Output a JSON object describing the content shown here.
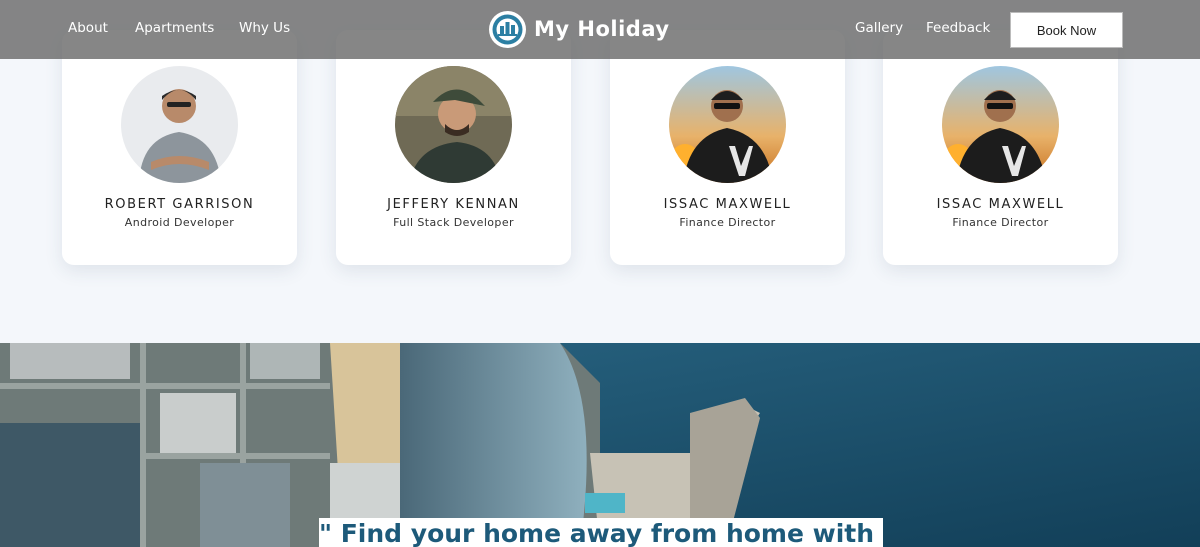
{
  "nav": {
    "left_links": [
      "About",
      "Apartments",
      "Why Us"
    ],
    "right_links": [
      "Gallery",
      "Feedback"
    ],
    "brand": "My Holiday",
    "book_label": "Book Now"
  },
  "team": [
    {
      "name": "ROBERT GARRISON",
      "role": "Android Developer"
    },
    {
      "name": "JEFFERY KENNAN",
      "role": "Full Stack Developer"
    },
    {
      "name": "ISSAC MAXWELL",
      "role": "Finance Director"
    },
    {
      "name": "ISSAC MAXWELL",
      "role": "Finance Director"
    }
  ],
  "hero": {
    "tagline": "\" Find your home away from home with us.\""
  },
  "colors": {
    "page_bg": "#f4f7fb",
    "navbar": "#646464",
    "tagline_text": "#1d5a7a",
    "sea": "#1f5673"
  }
}
